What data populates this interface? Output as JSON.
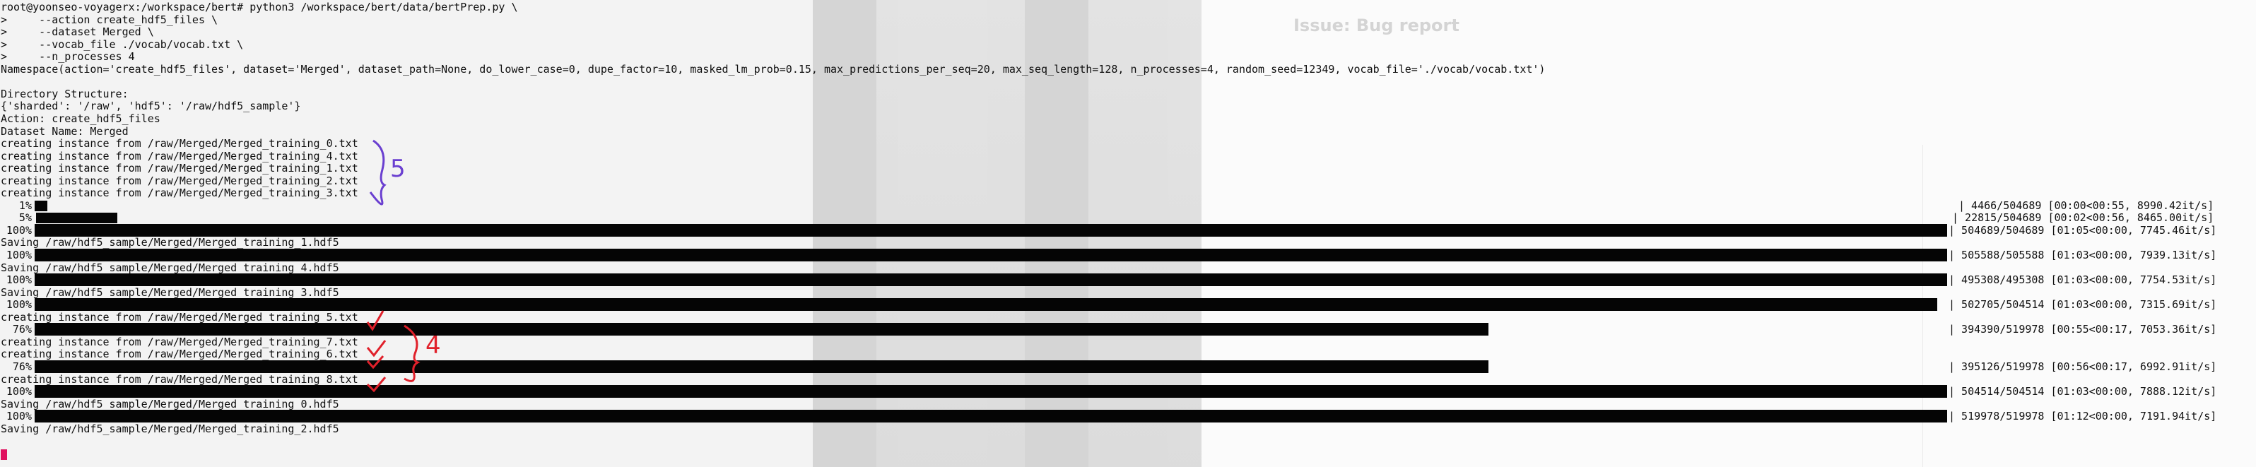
{
  "terminal": {
    "lines": [
      "root@yoonseo-voyagerx:/workspace/bert# python3 /workspace/bert/data/bertPrep.py \\",
      ">     --action create_hdf5_files \\",
      ">     --dataset Merged \\",
      ">     --vocab_file ./vocab/vocab.txt \\",
      ">     --n_processes 4",
      "Namespace(action='create_hdf5_files', dataset='Merged', dataset_path=None, do_lower_case=0, dupe_factor=10, masked_lm_prob=0.15, max_predictions_per_seq=20, max_seq_length=128, n_processes=4, random_seed=12349, vocab_file='./vocab/vocab.txt')",
      "",
      "Directory Structure:",
      "{'sharded': '/raw', 'hdf5': '/raw/hdf5_sample'}",
      "Action: create_hdf5_files",
      "Dataset Name: Merged",
      "creating instance from /raw/Merged/Merged_training_0.txt",
      "creating instance from /raw/Merged/Merged_training_4.txt",
      "creating instance from /raw/Merged/Merged_training_1.txt",
      "creating instance from /raw/Merged/Merged_training_2.txt",
      "creating instance from /raw/Merged/Merged_training_3.txt"
    ],
    "output_rows": [
      {
        "kind": "progress",
        "pct": "  1%",
        "fraction": 0.01,
        "stats": "| 4466/504689 [00:00<00:55, 8990.42it/s]"
      },
      {
        "kind": "progress",
        "pct": "  5%",
        "fraction": 0.045,
        "stats": "| 22815/504689 [00:02<00:56, 8465.00it/s]"
      },
      {
        "kind": "progress",
        "pct": "100%",
        "fraction": 1.0,
        "stats": "| 504689/504689 [01:05<00:00, 7745.46it/s]"
      },
      {
        "kind": "text",
        "text": "Saving /raw/hdf5_sample/Merged/Merged_training_1.hdf5"
      },
      {
        "kind": "progress",
        "pct": "100%",
        "fraction": 1.0,
        "stats": "| 505588/505588 [01:03<00:00, 7939.13it/s]"
      },
      {
        "kind": "text",
        "text": "Saving /raw/hdf5_sample/Merged/Merged_training_4.hdf5"
      },
      {
        "kind": "progress",
        "pct": "100%",
        "fraction": 1.0,
        "stats": "| 495308/495308 [01:03<00:00, 7754.53it/s]"
      },
      {
        "kind": "text",
        "text": "Saving /raw/hdf5_sample/Merged/Merged_training_3.hdf5"
      },
      {
        "kind": "progress",
        "pct": "100%",
        "fraction": 0.995,
        "stats": "| 502705/504514 [01:03<00:00, 7315.69it/s]"
      },
      {
        "kind": "text",
        "text": "creating instance from /raw/Merged/Merged_training_5.txt"
      },
      {
        "kind": "progress",
        "pct": " 76%",
        "fraction": 0.76,
        "stats": "| 394390/519978 [00:55<00:17, 7053.36it/s]"
      },
      {
        "kind": "text",
        "text": "creating instance from /raw/Merged/Merged_training_7.txt"
      },
      {
        "kind": "text",
        "text": "creating instance from /raw/Merged/Merged_training_6.txt"
      },
      {
        "kind": "progress",
        "pct": " 76%",
        "fraction": 0.76,
        "stats": "| 395126/519978 [00:56<00:17, 6992.91it/s]"
      },
      {
        "kind": "text",
        "text": "creating instance from /raw/Merged/Merged_training_8.txt"
      },
      {
        "kind": "progress",
        "pct": "100%",
        "fraction": 1.0,
        "stats": "| 504514/504514 [01:03<00:00, 7888.12it/s]"
      },
      {
        "kind": "text",
        "text": "Saving /raw/hdf5_sample/Merged/Merged_training_0.hdf5"
      },
      {
        "kind": "progress",
        "pct": "100%",
        "fraction": 1.0,
        "stats": "| 519978/519978 [01:12<00:00, 7191.94it/s]"
      },
      {
        "kind": "text",
        "text": "Saving /raw/hdf5_sample/Merged/Merged_training_2.hdf5"
      }
    ]
  },
  "annotations": {
    "group_a_count": "5",
    "group_b_count": "4",
    "check_mark": "✓",
    "ink_color": "#6a3fd0",
    "check_color": "#e0202a"
  },
  "background_window": {
    "title": "Issue: Bug report"
  },
  "colors": {
    "terminal_background": "#f3f3f3",
    "text": "#101010",
    "progress_bar": "#050505",
    "cursor": "#e0115f"
  }
}
